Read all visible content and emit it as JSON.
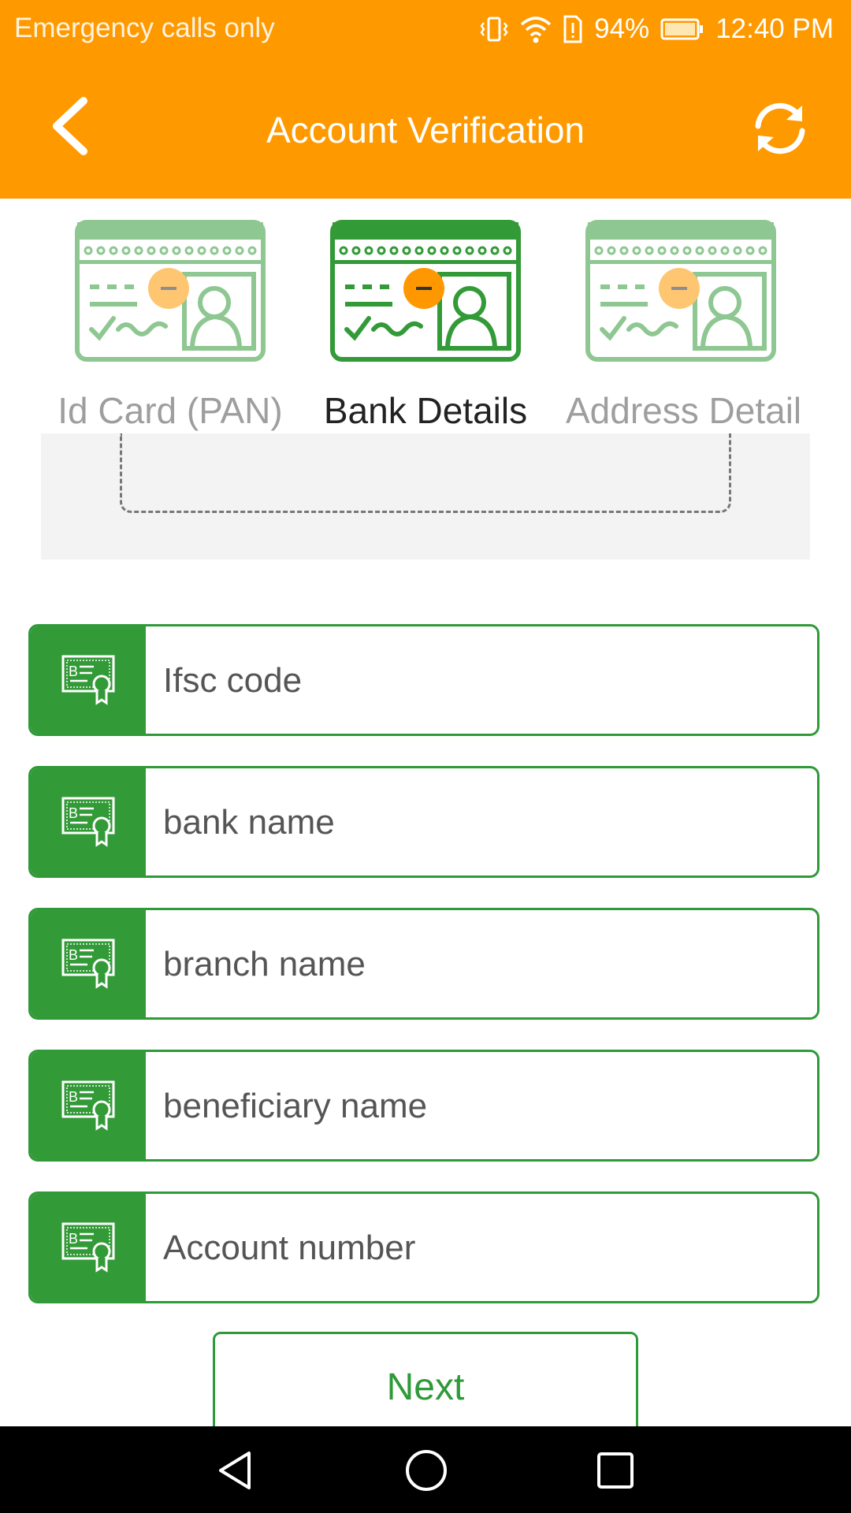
{
  "status_bar": {
    "carrier": "Emergency calls only",
    "battery": "94%",
    "time": "12:40 PM"
  },
  "header": {
    "title": "Account Verification"
  },
  "steps": [
    {
      "label": "Id Card (PAN)",
      "state": "inactive"
    },
    {
      "label": "Bank Details",
      "state": "active"
    },
    {
      "label": "Address Detail",
      "state": "inactive"
    }
  ],
  "form": {
    "fields": [
      {
        "placeholder": "Ifsc code",
        "value": ""
      },
      {
        "placeholder": "bank name",
        "value": ""
      },
      {
        "placeholder": "branch name",
        "value": ""
      },
      {
        "placeholder": "beneficiary name",
        "value": ""
      },
      {
        "placeholder": "Account number",
        "value": ""
      }
    ],
    "next_label": "Next"
  },
  "colors": {
    "header": "#ff9900",
    "accent_green": "#339a38",
    "inactive_green": "#8fd08f",
    "badge_orange": "#ff9800"
  },
  "icons": {
    "back": "chevron-left-icon",
    "refresh": "refresh-icon",
    "field": "bank-certificate-icon",
    "nav": [
      "back-triangle-icon",
      "home-circle-icon",
      "recents-square-icon"
    ]
  }
}
